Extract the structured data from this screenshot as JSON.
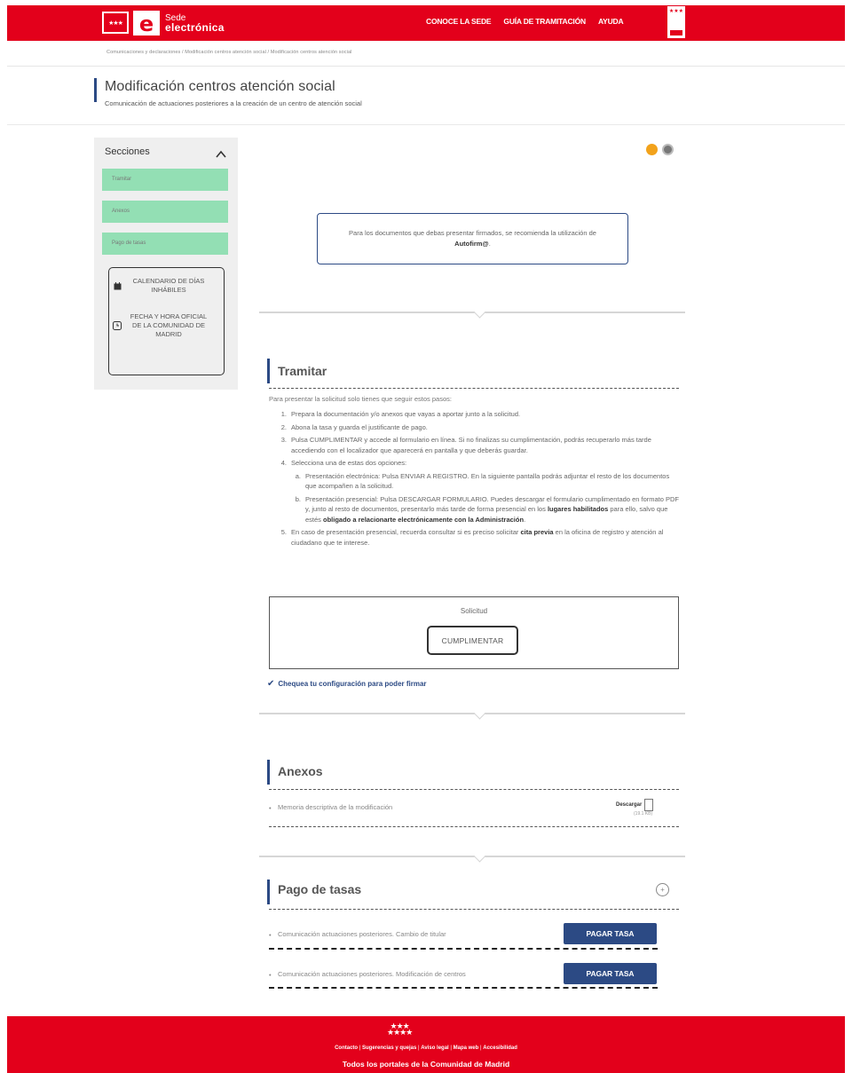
{
  "header": {
    "logo_line1": "Sede",
    "logo_line2": "electrónica",
    "nav": [
      "CONOCE LA SEDE",
      "GUÍA DE TRAMITACIÓN",
      "AYUDA"
    ]
  },
  "breadcrumb": "Comunicaciones y declaraciones / Modificación centros atención social / Modificación centros atención social",
  "page": {
    "title": "Modificación centros atención social",
    "subtitle": "Comunicación de actuaciones posteriores a la creación de un centro de atención social"
  },
  "sidebar": {
    "heading": "Secciones",
    "items": [
      "Tramitar",
      "Anexos",
      "Pago de tasas"
    ],
    "calendar_label": "CALENDARIO DE DÍAS INHÁBILES",
    "datetime_label": "FECHA Y HORA OFICIAL DE LA COMUNIDAD DE MADRID"
  },
  "info": {
    "text_pre": "Para los documentos que debas presentar firmados, se recomienda la utilización de ",
    "text_link": "Autofirm@",
    "text_post": "."
  },
  "tramitar": {
    "title": "Tramitar",
    "intro": "Para presentar la solicitud solo tienes que seguir estos pasos:",
    "step1": "Prepara la documentación y/o anexos que vayas a aportar junto a la solicitud.",
    "step2": "Abona la tasa y guarda el justificante de pago.",
    "step3": "Pulsa CUMPLIMENTAR y accede al formulario en línea. Si no finalizas su cumplimentación, podrás recuperarlo más tarde accediendo con el localizador que aparecerá en pantalla y que deberás guardar.",
    "step4": "Selecciona una de estas dos opciones:",
    "step4a": "Presentación electrónica: Pulsa ENVIAR A REGISTRO. En la siguiente pantalla podrás adjuntar el resto de los documentos que acompañen a la solicitud.",
    "step4b_pre": "Presentación presencial: Pulsa DESCARGAR FORMULARIO. Puedes descargar el formulario cumplimentado en formato PDF y, junto al resto de documentos, presentarlo más tarde de forma presencial en los ",
    "step4b_link1": "lugares habilitados",
    "step4b_mid": " para ello, salvo que estés ",
    "step4b_link2": "obligado a relacionarte electrónicamente con la Administración",
    "step4b_post": ".",
    "step5_pre": "En caso de presentación presencial, recuerda consultar si es preciso solicitar ",
    "step5_link": "cita previa",
    "step5_post": " en la oficina de registro y atención al ciudadano que te interese.",
    "solicitud_label": "Solicitud",
    "cumplimentar": "CUMPLIMENTAR",
    "chequea": "Chequea tu configuración para poder firmar"
  },
  "anexos": {
    "title": "Anexos",
    "item": "Memoria descriptiva de la modificación",
    "download": "Descargar",
    "size": "(19.1 KB)"
  },
  "pago": {
    "title": "Pago de tasas",
    "toggle": "+",
    "rows": [
      {
        "label": "Comunicación actuaciones posteriores. Cambio de titular",
        "button": "PAGAR TASA"
      },
      {
        "label": "Comunicación actuaciones posteriores. Modificación de centros",
        "button": "PAGAR TASA"
      }
    ]
  },
  "footer": {
    "links": [
      "Contacto",
      "Sugerencias y quejas",
      "Aviso legal",
      "Mapa web",
      "Accesibilidad"
    ],
    "all_portals": "Todos los portales de la Comunidad de Madrid"
  },
  "colors": {
    "brand_red": "#e3001b",
    "navy": "#2c4a84",
    "section_green": "#93dfb4"
  }
}
